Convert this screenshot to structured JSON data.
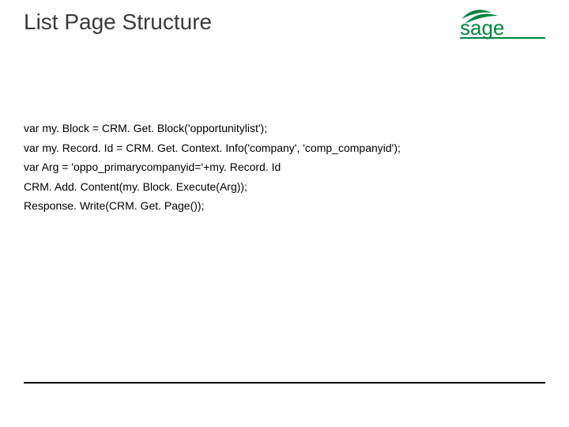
{
  "title": "List Page Structure",
  "logo": {
    "brand_name": "sage",
    "color": "#00843f"
  },
  "code": {
    "lines": [
      "var my. Block = CRM. Get. Block('opportunitylist');",
      "var my. Record. Id = CRM. Get. Context. Info('company', 'comp_companyid');",
      "var Arg = 'oppo_primarycompanyid='+my. Record. Id",
      "CRM. Add. Content(my. Block. Execute(Arg));",
      "Response. Write(CRM. Get. Page());"
    ]
  }
}
